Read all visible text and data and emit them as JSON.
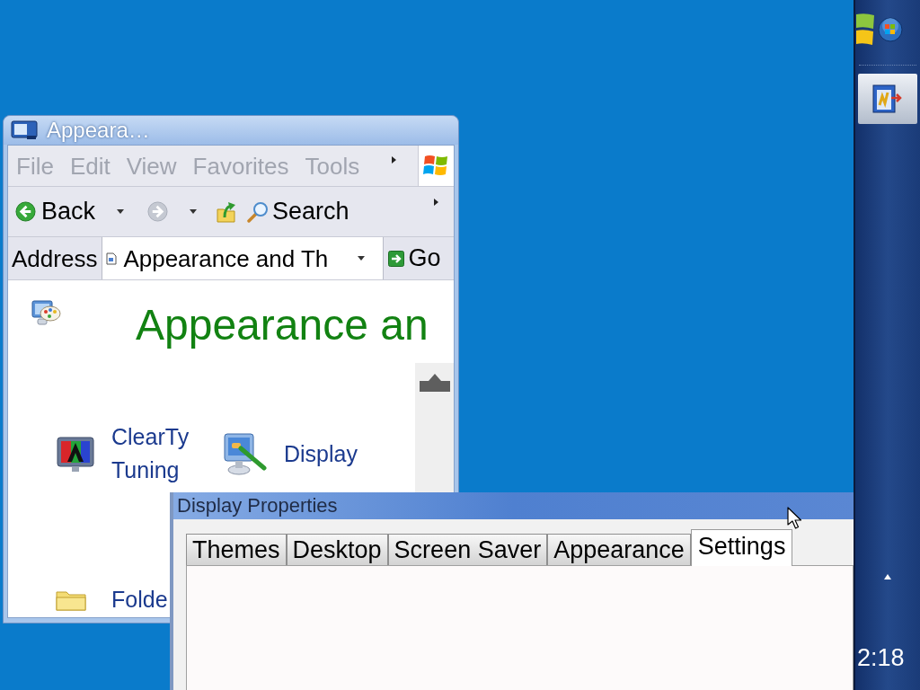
{
  "explorer_window": {
    "title": "Appeara…",
    "menu": [
      "File",
      "Edit",
      "View",
      "Favorites",
      "Tools"
    ],
    "toolbar": {
      "back": "Back",
      "search": "Search"
    },
    "address_bar": {
      "label": "Address",
      "value": "Appearance and Th",
      "go": "Go"
    },
    "heading": "Appearance an",
    "tasks": [
      {
        "label": "ClearTy Tuning"
      },
      {
        "label": "Display"
      },
      {
        "label": "Folde"
      }
    ]
  },
  "display_properties": {
    "title": "Display Properties",
    "tabs": [
      {
        "label": "Themes",
        "selected": false
      },
      {
        "label": "Desktop",
        "selected": false
      },
      {
        "label": "Screen Saver",
        "selected": false
      },
      {
        "label": "Appearance",
        "selected": false
      },
      {
        "label": "Settings",
        "selected": true
      }
    ]
  },
  "taskbar": {
    "clock": "2:18"
  }
}
